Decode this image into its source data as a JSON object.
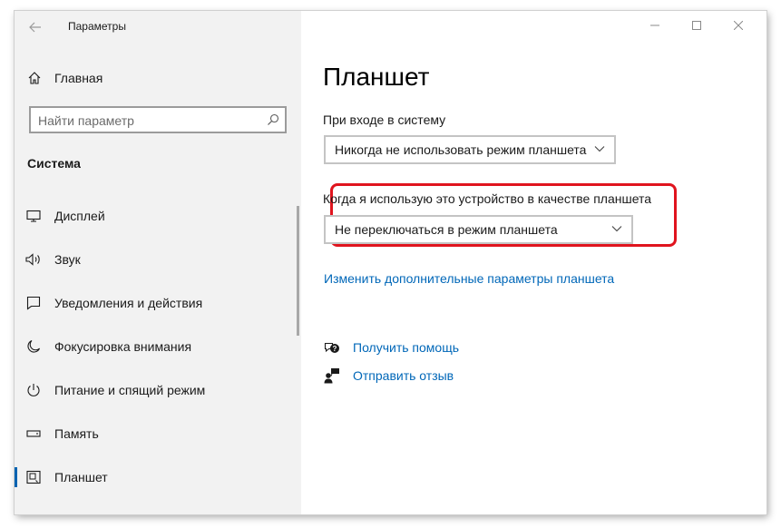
{
  "window": {
    "title": "Параметры",
    "controls": [
      "minimize",
      "maximize",
      "close"
    ]
  },
  "sidebar": {
    "home_label": "Главная",
    "search_placeholder": "Найти параметр",
    "section_title": "Система",
    "items": [
      {
        "label": "Дисплей",
        "icon": "display-icon"
      },
      {
        "label": "Звук",
        "icon": "speaker-icon"
      },
      {
        "label": "Уведомления и действия",
        "icon": "notification-icon"
      },
      {
        "label": "Фокусировка внимания",
        "icon": "moon-icon"
      },
      {
        "label": "Питание и спящий режим",
        "icon": "power-icon"
      },
      {
        "label": "Память",
        "icon": "storage-icon"
      },
      {
        "label": "Планшет",
        "icon": "tablet-icon",
        "selected": true
      }
    ]
  },
  "main": {
    "page_title": "Планшет",
    "signin_label": "При входе в систему",
    "signin_value": "Никогда не использовать режим планшета",
    "tablet_use_label": "Когда я использую это устройство в качестве планшета",
    "tablet_use_value": "Не переключаться в режим планшета",
    "advanced_link": "Изменить дополнительные параметры планшета",
    "get_help_link": "Получить помощь",
    "feedback_link": "Отправить отзыв"
  },
  "colors": {
    "accent": "#0067b8",
    "highlight": "#e0141e",
    "sidebar_bg": "#f2f2f2"
  }
}
